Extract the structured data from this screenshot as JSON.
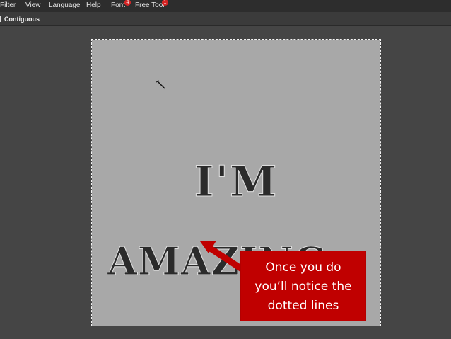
{
  "menubar": {
    "items": [
      {
        "label": "Filter"
      },
      {
        "label": "View"
      },
      {
        "label": "Language"
      },
      {
        "label": "Help"
      },
      {
        "label": "Font",
        "badge": "4"
      },
      {
        "label": "Free Tool",
        "badge": "1"
      }
    ]
  },
  "options_bar": {
    "contiguous_label": "Contiguous",
    "contiguous_checked": true
  },
  "canvas": {
    "text_line1": "I'M",
    "text_line2": "AMAZING",
    "background_color": "#a8a8a8",
    "text_color": "#2b2b2b"
  },
  "callout": {
    "lines": [
      "Once you do",
      "you’ll notice the",
      "dotted lines"
    ],
    "background_color": "#c00000",
    "arrow_color": "#c00000"
  },
  "tool_cursor": "magic-wand-icon"
}
